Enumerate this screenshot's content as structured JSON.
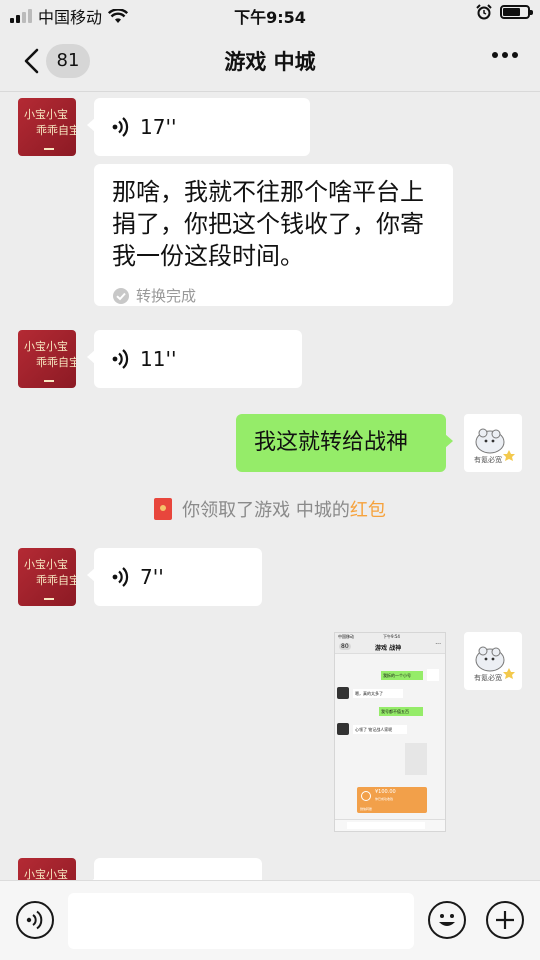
{
  "status": {
    "carrier": "中国移动",
    "time": "下午9:54"
  },
  "nav": {
    "back_count": "81",
    "title": "游戏 中城"
  },
  "avatars": {
    "left_line1": "小宝小宝",
    "left_line2": "乖乖自宝",
    "right_caption": "有氪必宽"
  },
  "messages": {
    "voice1": "17''",
    "text1": "那啥，我就不往那个啥平台上捐了，你把这个钱收了，你寄我一份这段时间。",
    "convert_status": "转换完成",
    "voice2": "11''",
    "sent_text": "我这就转给战神",
    "system_prefix": "你领取了游戏 中城的",
    "system_link": "红包",
    "voice3": "7''"
  },
  "screenshot": {
    "status_time": "下午9:54",
    "carrier": "中国移动",
    "back_count": "80",
    "title": "游戏 战神",
    "msg1": "我拆的一个小号",
    "msg2": "嗯，真的太多了",
    "msg3": "我号都不值五百",
    "msg4": "心领了 铭记战人家呢",
    "amount": "¥100.00",
    "pay_line": "你已成功收钱",
    "footer": "微信转账"
  }
}
